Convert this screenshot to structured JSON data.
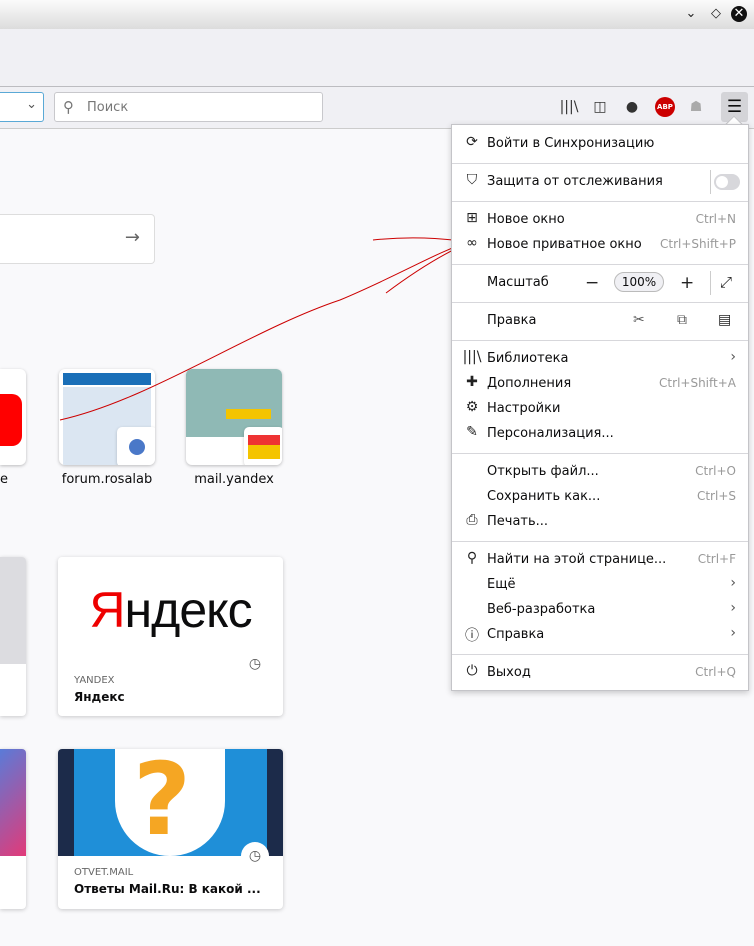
{
  "window": {
    "controls": [
      "minimize",
      "maximize",
      "close"
    ]
  },
  "toolbar": {
    "search_placeholder": "Поиск",
    "icons": [
      "library-icon",
      "sidebar-icon",
      "extension-icon",
      "adblock-icon",
      "ghostery-icon",
      "menu-icon"
    ],
    "abp_label": "ABP"
  },
  "tiles": [
    {
      "label": "e"
    },
    {
      "label": "forum.rosalab"
    },
    {
      "label": "mail.yandex"
    }
  ],
  "highlights": [
    {
      "source": "",
      "title": ""
    },
    {
      "source": "yandex",
      "title": "Яндекс",
      "logo": "Яндекс"
    },
    {
      "source": "",
      "title": ""
    },
    {
      "source": "otvet.mail",
      "title": "Ответы Mail.Ru: В какой ..."
    }
  ],
  "menu": {
    "sync": "Войти в Синхронизацию",
    "tracking": "Защита от отслеживания",
    "new_window": {
      "label": "Новое окно",
      "shortcut": "Ctrl+N"
    },
    "private_window": {
      "label": "Новое приватное окно",
      "shortcut": "Ctrl+Shift+P"
    },
    "zoom": {
      "label": "Масштаб",
      "value": "100%",
      "minus": "−",
      "plus": "+"
    },
    "edit": "Правка",
    "library": "Библиотека",
    "addons": {
      "label": "Дополнения",
      "shortcut": "Ctrl+Shift+A"
    },
    "settings": "Настройки",
    "customize": "Персонализация...",
    "open_file": {
      "label": "Открыть файл...",
      "shortcut": "Ctrl+O"
    },
    "save_as": {
      "label": "Сохранить как...",
      "shortcut": "Ctrl+S"
    },
    "print": "Печать...",
    "find": {
      "label": "Найти на этой странице...",
      "shortcut": "Ctrl+F"
    },
    "more": "Ещё",
    "webdev": "Веб-разработка",
    "help": "Справка",
    "exit": {
      "label": "Выход",
      "shortcut": "Ctrl+Q"
    }
  },
  "colors": {
    "accent": "#0a84ff",
    "annotation": "#cc0000"
  }
}
